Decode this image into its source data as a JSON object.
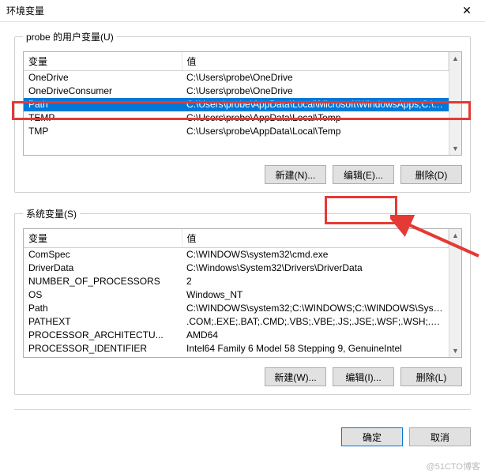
{
  "title": "环境变量",
  "close_glyph": "✕",
  "user_vars": {
    "legend": "probe 的用户变量(U)",
    "col_var": "变量",
    "col_val": "值",
    "rows": [
      {
        "var": "OneDrive",
        "val": "C:\\Users\\probe\\OneDrive",
        "selected": false
      },
      {
        "var": "OneDriveConsumer",
        "val": "C:\\Users\\probe\\OneDrive",
        "selected": false
      },
      {
        "var": "Path",
        "val": "C:\\Users\\probe\\AppData\\Local\\Microsoft\\WindowsApps;C:\\Too...",
        "selected": true
      },
      {
        "var": "TEMP",
        "val": "C:\\Users\\probe\\AppData\\Local\\Temp",
        "selected": false
      },
      {
        "var": "TMP",
        "val": "C:\\Users\\probe\\AppData\\Local\\Temp",
        "selected": false
      }
    ],
    "buttons": {
      "new": "新建(N)...",
      "edit": "编辑(E)...",
      "delete": "删除(D)"
    }
  },
  "sys_vars": {
    "legend": "系统变量(S)",
    "col_var": "变量",
    "col_val": "值",
    "rows": [
      {
        "var": "ComSpec",
        "val": "C:\\WINDOWS\\system32\\cmd.exe"
      },
      {
        "var": "DriverData",
        "val": "C:\\Windows\\System32\\Drivers\\DriverData"
      },
      {
        "var": "NUMBER_OF_PROCESSORS",
        "val": "2"
      },
      {
        "var": "OS",
        "val": "Windows_NT"
      },
      {
        "var": "Path",
        "val": "C:\\WINDOWS\\system32;C:\\WINDOWS;C:\\WINDOWS\\System3..."
      },
      {
        "var": "PATHEXT",
        "val": ".COM;.EXE;.BAT;.CMD;.VBS;.VBE;.JS;.JSE;.WSF;.WSH;.MSC"
      },
      {
        "var": "PROCESSOR_ARCHITECTU...",
        "val": "AMD64"
      },
      {
        "var": "PROCESSOR_IDENTIFIER",
        "val": "Intel64 Family 6 Model 58 Stepping 9, GenuineIntel"
      }
    ],
    "buttons": {
      "new": "新建(W)...",
      "edit": "编辑(I)...",
      "delete": "删除(L)"
    }
  },
  "dialog_buttons": {
    "ok": "确定",
    "cancel": "取消"
  },
  "watermark": "@51CTO博客",
  "annotation": {
    "color": "#e53935"
  }
}
